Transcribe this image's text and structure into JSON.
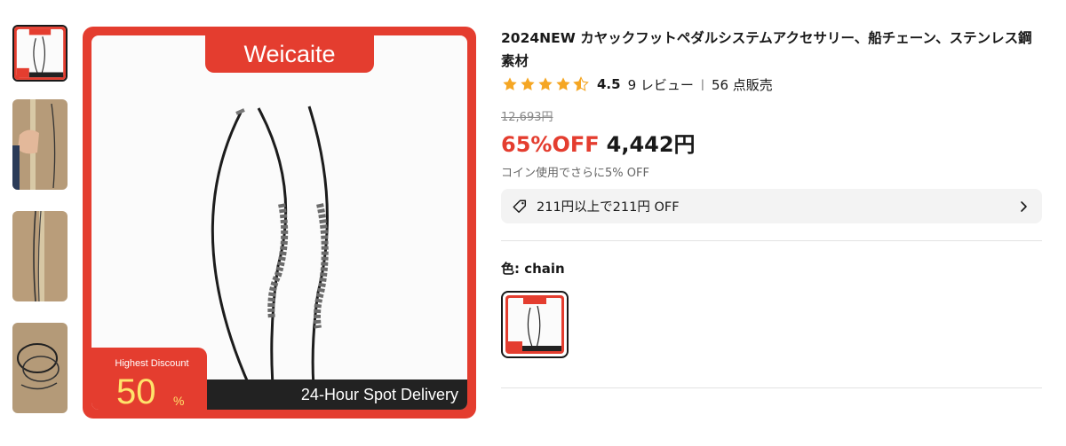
{
  "gallery": {
    "brand": "Weicaite",
    "badge_label": "Highest Discount",
    "badge_value": "50",
    "badge_unit": "%",
    "delivery_text": "24-Hour Spot Delivery",
    "thumbnails": [
      "product-image",
      "measuring-photo",
      "photo-on-floor",
      "coiled-cables-photo"
    ]
  },
  "product": {
    "title": "2024NEW カヤックフットペダルシステムアクセサリー、船チェーン、ステンレス鋼素材",
    "rating": "4.5",
    "rating_value": 4.5,
    "reviews": "9 レビュー",
    "separator": "|",
    "sold": "56 点販売",
    "original_price": "12,693円",
    "discount": "65%OFF",
    "price": "4,442円",
    "coin_note": "コイン使用でさらに5% OFF",
    "coupon": "211円以上で211円 OFF",
    "color_label": "色: chain"
  },
  "colors": {
    "accent": "#e43d2f",
    "star": "#f5a623",
    "text": "#191919",
    "muted": "#888888"
  },
  "icons": [
    "star-icon",
    "tag-icon",
    "chevron-right-icon"
  ]
}
